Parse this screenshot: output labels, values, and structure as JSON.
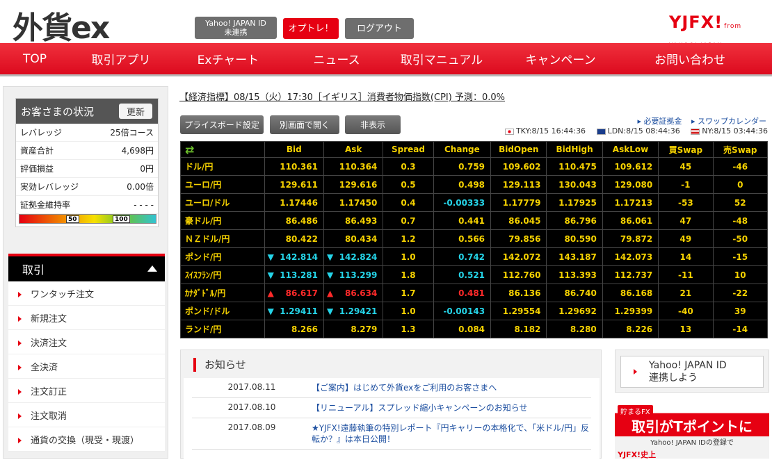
{
  "header": {
    "logo": "外貨ex",
    "yahoo_line1": "Yahoo! JAPAN ID",
    "yahoo_line2": "未連携",
    "optore": "オプトレ！",
    "logout": "ログアウト",
    "brand": "YJFX!",
    "brand_sub": "from YAHOO! JAPAN"
  },
  "nav": [
    "TOP",
    "取引アプリ",
    "Exチャート",
    "ニュース",
    "取引マニュアル",
    "キャンペーン",
    "お問い合わせ"
  ],
  "status": {
    "title": "お客さまの状況",
    "renew": "更新",
    "rows": [
      {
        "label": "レバレッジ",
        "value": "25倍コース"
      },
      {
        "label": "資産合計",
        "value": "4,698円"
      },
      {
        "label": "評価損益",
        "value": "0円"
      },
      {
        "label": "実効レバレッジ",
        "value": "0.00倍"
      },
      {
        "label": "証拠金維持率",
        "value": "- - - -"
      }
    ],
    "gauge_marks": [
      "50",
      "100"
    ]
  },
  "torihiki": {
    "title": "取引",
    "items": [
      "ワンタッチ注文",
      "新規注文",
      "決済注文",
      "全決済",
      "注文訂正",
      "注文取消",
      "通貨の交換（現受・現渡）"
    ]
  },
  "ticker": "【経済指標】08/15（火）17:30［イギリス］消費者物価指数(CPI) 予測：0.0%",
  "toolbar": {
    "board_settings": "プライスボード設定",
    "open_new": "別画面で開く",
    "hide": "非表示"
  },
  "links": [
    "必要証拠金",
    "スワップカレンダー"
  ],
  "clocks": [
    {
      "flag": "jp",
      "text": "TKY:8/15 16:44:36"
    },
    {
      "flag": "uk",
      "text": "LDN:8/15 08:44:36"
    },
    {
      "flag": "us",
      "text": "NY:8/15 03:44:36"
    }
  ],
  "board": {
    "headers": [
      "Bid",
      "Ask",
      "Spread",
      "Change",
      "BidOpen",
      "BidHigh",
      "AskLow",
      "買Swap",
      "売Swap"
    ],
    "rows": [
      {
        "pair": "ドル/円",
        "bid": "110.361",
        "ask": "110.364",
        "spread": "0.3",
        "change": "0.759",
        "open": "109.602",
        "high": "110.475",
        "low": "109.612",
        "buy": "45",
        "sell": "-46",
        "dir": ""
      },
      {
        "pair": "ユーロ/円",
        "bid": "129.611",
        "ask": "129.616",
        "spread": "0.5",
        "change": "0.498",
        "open": "129.113",
        "high": "130.043",
        "low": "129.080",
        "buy": "-1",
        "sell": "0",
        "dir": ""
      },
      {
        "pair": "ユーロ/ドル",
        "bid": "1.17446",
        "ask": "1.17450",
        "spread": "0.4",
        "change": "-0.00333",
        "open": "1.17779",
        "high": "1.17925",
        "low": "1.17213",
        "buy": "-53",
        "sell": "52",
        "dir": ""
      },
      {
        "pair": "豪ドル/円",
        "bid": "86.486",
        "ask": "86.493",
        "spread": "0.7",
        "change": "0.441",
        "open": "86.045",
        "high": "86.796",
        "low": "86.061",
        "buy": "47",
        "sell": "-48",
        "dir": ""
      },
      {
        "pair": "ＮＺドル/円",
        "bid": "80.422",
        "ask": "80.434",
        "spread": "1.2",
        "change": "0.566",
        "open": "79.856",
        "high": "80.590",
        "low": "79.872",
        "buy": "49",
        "sell": "-50",
        "dir": ""
      },
      {
        "pair": "ポンド/円",
        "bid": "142.814",
        "ask": "142.824",
        "spread": "1.0",
        "change": "0.742",
        "open": "142.072",
        "high": "143.187",
        "low": "142.073",
        "buy": "14",
        "sell": "-15",
        "dir": "down"
      },
      {
        "pair": "ｽｲｽﾌﾗﾝ/円",
        "bid": "113.281",
        "ask": "113.299",
        "spread": "1.8",
        "change": "0.521",
        "open": "112.760",
        "high": "113.393",
        "low": "112.737",
        "buy": "-11",
        "sell": "10",
        "dir": "down"
      },
      {
        "pair": "ｶﾅﾀﾞﾄﾞﾙ/円",
        "bid": "86.617",
        "ask": "86.634",
        "spread": "1.7",
        "change": "0.481",
        "open": "86.136",
        "high": "86.740",
        "low": "86.168",
        "buy": "21",
        "sell": "-22",
        "dir": "up"
      },
      {
        "pair": "ポンド/ドル",
        "bid": "1.29411",
        "ask": "1.29421",
        "spread": "1.0",
        "change": "-0.00143",
        "open": "1.29554",
        "high": "1.29692",
        "low": "1.29399",
        "buy": "-40",
        "sell": "39",
        "dir": "down"
      },
      {
        "pair": "ランド/円",
        "bid": "8.266",
        "ask": "8.279",
        "spread": "1.3",
        "change": "0.084",
        "open": "8.182",
        "high": "8.280",
        "low": "8.226",
        "buy": "13",
        "sell": "-14",
        "dir": ""
      }
    ]
  },
  "news": {
    "title": "お知らせ",
    "items": [
      {
        "date": "2017.08.11",
        "text": "【ご案内】はじめて外貨exをご利用のお客さまへ"
      },
      {
        "date": "2017.08.10",
        "text": "【リニューアル】スプレッド縮小キャンペーンのお知らせ"
      },
      {
        "date": "2017.08.09",
        "text": "★YJFX!遠藤執筆の特別レポート『円キャリーの本格化で、「米ドル/円」反転か？』は本日公開！"
      }
    ]
  },
  "yj_link": {
    "line1": "Yahoo! JAPAN ID",
    "line2": "連携しよう"
  },
  "banner": {
    "tag": "貯まるFX",
    "main": "取引がTポイントに",
    "sub": "Yahoo! JAPAN IDの登録で",
    "foot": "YJFX!史上"
  },
  "colors": {
    "accent": "#e60012",
    "board_bg": "#000000",
    "board_text": "#f6d200",
    "board_cyan": "#25d4e8"
  }
}
